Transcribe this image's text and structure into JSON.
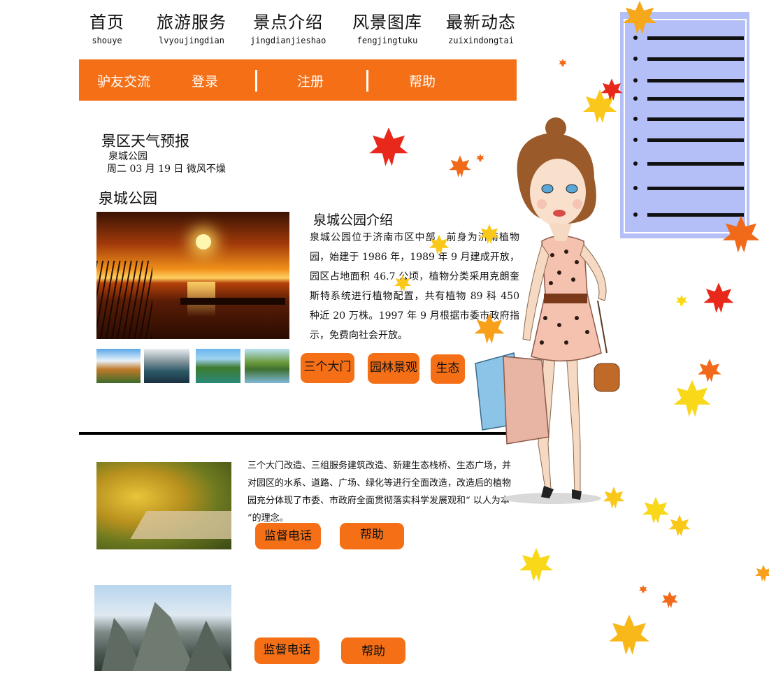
{
  "nav": {
    "items": [
      {
        "zh": "首页",
        "py": "shouye"
      },
      {
        "zh": "旅游服务",
        "py": "lvyoujingdian"
      },
      {
        "zh": "景点介绍",
        "py": "jingdianjieshao"
      },
      {
        "zh": "风景图库",
        "py": "fengjingtuku"
      },
      {
        "zh": "最新动态",
        "py": "zuixindongtai"
      }
    ]
  },
  "orange_bar": {
    "items": [
      "驴友交流",
      "登录",
      "注册",
      "帮助"
    ],
    "color": "#f46f16"
  },
  "weather": {
    "title": "景区天气预报",
    "place": "泉城公园",
    "line": "周二 03 月 19 日 微风不燥"
  },
  "park": {
    "title": "泉城公园",
    "intro_title": "泉城公园介绍",
    "intro_text": "泉城公园位于济南市区中部，前身为济南植物园，始建于 1986 年，1989 年 9 月建成开放， 园区占地面积 46.7 公顷，植物分类采用克朗奎斯特系统进行植物配置，共有植物 89 科 450 种近 20 万株。1997 年 9 月根据市委市政府指示，免费向社会开放。",
    "buttons": [
      "三个大门",
      "园林景观",
      "生态"
    ]
  },
  "gate": {
    "text": "三个大门改造、三组服务建筑改造、新建生态栈桥、生态广场，并对园区的水系、道路、广场、绿化等进行全面改造，改造后的植物园充分体现了市委、市政府全面贯彻落实科学发展观和“ 以人为本 ”的理念。",
    "buttons": [
      "监督电话",
      "帮助"
    ]
  },
  "bottom": {
    "buttons": [
      "监督电话",
      "帮助"
    ]
  },
  "side_panel": {
    "color": "#b3bff6",
    "item_count": 9
  }
}
